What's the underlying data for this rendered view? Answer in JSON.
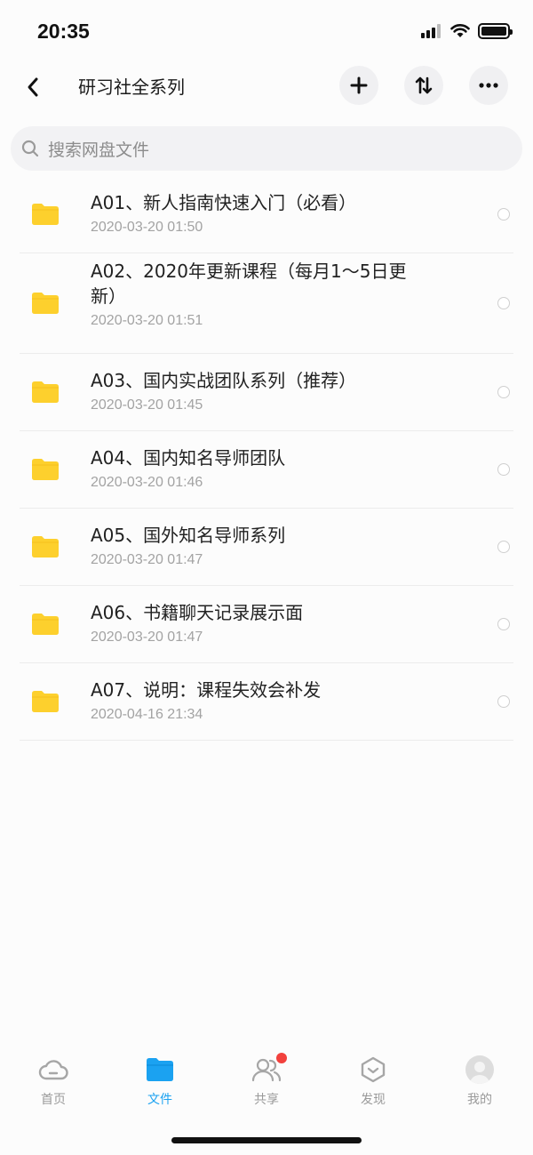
{
  "status_bar": {
    "time": "20:35"
  },
  "header": {
    "title": "研习社全系列"
  },
  "search": {
    "placeholder": "搜索网盘文件"
  },
  "files": [
    {
      "name": "A01、新人指南快速入门（必看）",
      "date": "2020-03-20 01:50"
    },
    {
      "name": "A02、2020年更新课程（每月1～5日更新）",
      "date": "2020-03-20 01:51"
    },
    {
      "name": "A03、国内实战团队系列（推荐）",
      "date": "2020-03-20 01:45"
    },
    {
      "name": "A04、国内知名导师团队",
      "date": "2020-03-20 01:46"
    },
    {
      "name": "A05、国外知名导师系列",
      "date": "2020-03-20 01:47"
    },
    {
      "name": "A06、书籍聊天记录展示面",
      "date": "2020-03-20 01:47"
    },
    {
      "name": "A07、说明：课程失效会补发",
      "date": "2020-04-16 21:34"
    }
  ],
  "tabs": [
    {
      "label": "首页",
      "icon": "cloud-icon"
    },
    {
      "label": "文件",
      "icon": "folder-icon",
      "active": true
    },
    {
      "label": "共享",
      "icon": "share-users-icon",
      "badge": true
    },
    {
      "label": "发现",
      "icon": "discover-icon"
    },
    {
      "label": "我的",
      "icon": "avatar"
    }
  ],
  "colors": {
    "accent": "#1ba2f1",
    "folder": "#fdd02d",
    "badge": "#f2413d"
  }
}
